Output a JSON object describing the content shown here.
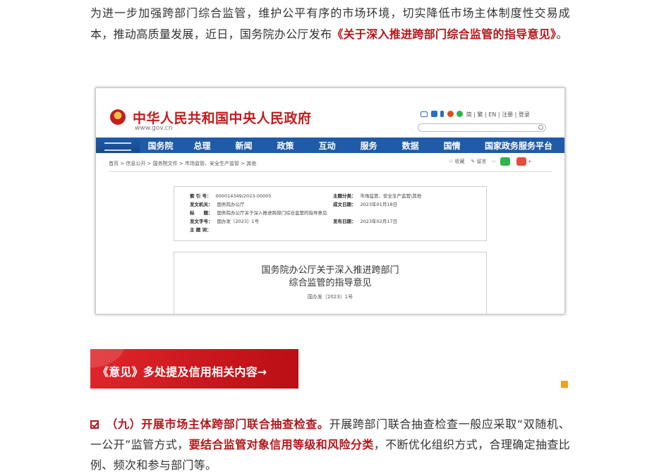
{
  "intro": {
    "text": "为进一步加强跨部门综合监管，维护公平有序的市场环境，切实降低市场主体制度性交易成本，推动高质量发展，近日，国务院办公厅发布",
    "doc_link": "《关于深入推进跨部门综合监管的指导意见》",
    "tail": "。"
  },
  "screenshot": {
    "site_title": "中华人民共和国中央人民政府",
    "site_url": "www.gov.cn",
    "top_links": "简 | 繁 | EN | 注册 | 登录",
    "nav": [
      "国务院",
      "总理",
      "新闻",
      "政策",
      "互动",
      "服务",
      "数据",
      "国情",
      "国家政务服务平台"
    ],
    "breadcrumb": "首页 > 信息公开 > 国务院文件 > 市场监管、安全生产监管 > 其他",
    "tools": {
      "fav": "收藏",
      "print": "留言"
    },
    "meta": {
      "index_label": "索 引 号：",
      "index_value": "000014349/2023-00005",
      "topic_label": "主题分类：",
      "topic_value": "市场监管、安全生产监管\\其他",
      "issuer_label": "发文机关：",
      "issuer_value": "国务院办公厅",
      "date_label": "成文日期：",
      "date_value": "2023年01月18日",
      "title_label": "标　　题：",
      "title_value": "国务院办公厅关于深入推进跨部门综合监管的指导意见",
      "docno_label": "发文字号：",
      "docno_value": "国办发〔2023〕1号",
      "pubdate_label": "发布日期：",
      "pubdate_value": "2023年02月17日",
      "subject_label": "主 题 词："
    },
    "doc_title_line1": "国务院办公厅关于深入推进跨部门",
    "doc_title_line2": "综合监管的指导意见",
    "doc_number": "国办发〔2023〕1号"
  },
  "banner": {
    "text": "《意见》多处提及信用相关内容→"
  },
  "section_nine": {
    "heading": "（九）开展市场主体跨部门联合抽查检查。",
    "text1": "开展跨部门联合抽查检查一般应采取“双随机、一公开”监管方式，",
    "emphasis": "要结合监管对象信用等级和风险分类",
    "text2": "，不断优化组织方式，合理确定抽查比例、频次和参与部门等。"
  },
  "colors": {
    "accent_red": "#b4161b",
    "gov_blue": "#1f5ba8",
    "banner_red": "#d11f24",
    "orange": "#f0a020"
  }
}
